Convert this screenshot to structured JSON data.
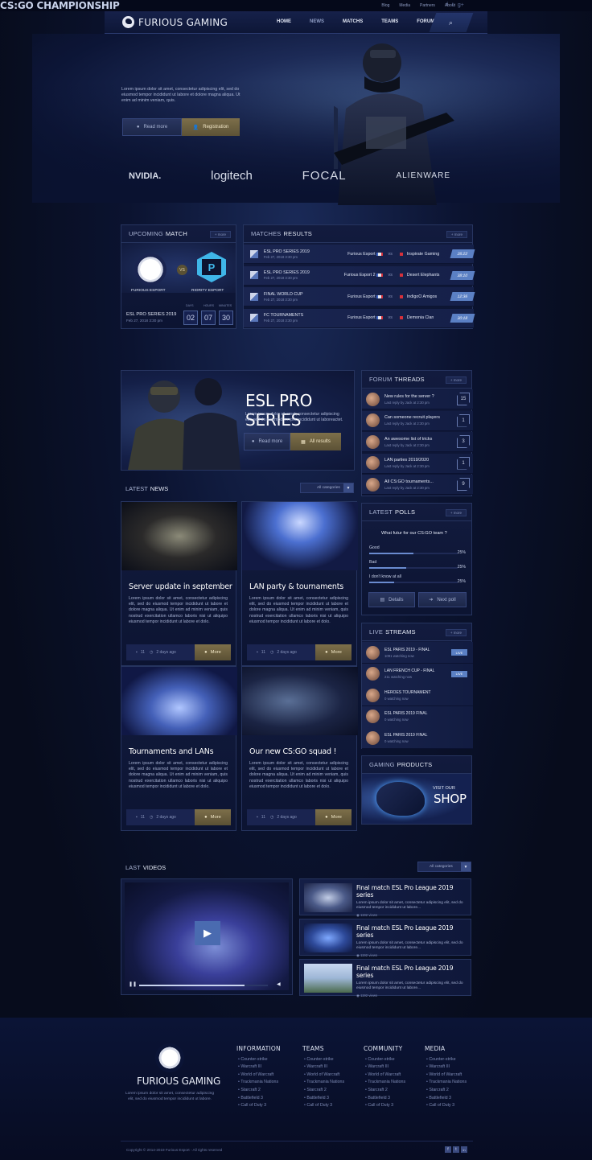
{
  "topbar": {
    "links": [
      "Blog",
      "Media",
      "Partners",
      "About"
    ],
    "social": [
      "f",
      "t",
      "g+"
    ]
  },
  "brand": {
    "name": "FURIOUS GAMING"
  },
  "nav": {
    "items": [
      "HOME",
      "NEWS",
      "MATCHS",
      "TEAMS",
      "FORUMS"
    ],
    "active": "NEWS"
  },
  "hero": {
    "title": "CS:GO CHAMPIONSHIP",
    "desc": "Lorem ipsum dolor sit amet, consectetur adipiscing elit, sed do eiusmod tempor incididunt ut labore et dolore magna aliqua. Ut enim ad minim veniam, quis.",
    "btn_read": "Read more",
    "btn_reg": "Registration"
  },
  "sponsors": [
    "NVIDIA.",
    "logitech",
    "FOCAL",
    "ALIENWARE"
  ],
  "upcoming": {
    "title_a": "UPCOMING",
    "title_b": "MATCH",
    "more": "+ more",
    "team1": "FURIOUS ESPORT",
    "team2": "RIORITY ESPORT",
    "vs": "VS",
    "event": "ESL PRO SERIES 2019",
    "date": "Feb 27, 2018 3:30 pm",
    "cd_labels": [
      "DAYS",
      "HOURS",
      "MINUTES"
    ],
    "cd_values": [
      "02",
      "07",
      "30"
    ]
  },
  "results": {
    "title_a": "MATCHES",
    "title_b": "RESULTS",
    "more": "+ more",
    "rows": [
      {
        "event": "ESL PRO SERIES 2019",
        "date": "Feb 27, 2018 3:30 pm",
        "home": "Furious Esport",
        "away": "Inspirate Gaming",
        "score": "26:22"
      },
      {
        "event": "ESL PRO SERIES 2019",
        "date": "Feb 27, 2018 3:30 pm",
        "home": "Furious Esport 2",
        "away": "Desert Elephants",
        "score": "38:10"
      },
      {
        "event": "FINAL WORLD CUP",
        "date": "Feb 27, 2018 3:30 pm",
        "home": "Furious Esport",
        "away": "IndigoO Amigos",
        "score": "12:36"
      },
      {
        "event": "FC TOURNAMENTS",
        "date": "Feb 27, 2018 3:30 pm",
        "home": "Furious Esport",
        "away": "Demonia Clan",
        "score": "30:18"
      }
    ],
    "vs": "vs"
  },
  "esl": {
    "title": "ESL PRO SERIES",
    "desc": "Lorem ipsum dolor sit amet, consectetur adipiscing elit, sed do eiusmod tempor incididunt ut laboreactet.",
    "btn_read": "Read more",
    "btn_all": "All results"
  },
  "threads": {
    "title_a": "FORUM",
    "title_b": "THREADS",
    "more": "+ more",
    "rows": [
      {
        "title": "New rules for the server ?",
        "meta": "Last reply by Jack at 2:30 pm",
        "count": "15"
      },
      {
        "title": "Can someone recruit players",
        "meta": "Last reply by Jack at 2:30 pm",
        "count": "1"
      },
      {
        "title": "An awesome list of tricks",
        "meta": "Last reply by Jack at 2:30 pm",
        "count": "3"
      },
      {
        "title": "LAN parties 2019/2020",
        "meta": "Last reply by Jack at 2:30 pm",
        "count": "1"
      },
      {
        "title": "All CS:GO tournaments...",
        "meta": "Last reply by Jack at 2:30 pm",
        "count": "9"
      }
    ]
  },
  "news": {
    "title_a": "LATEST",
    "title_b": "NEWS",
    "filter": "All categories",
    "items": [
      {
        "title": "Server update in september",
        "text": "Lorem ipsum dolor sit amet, consectetur adipiscing elit, sed do eiusmod tempor incididunt ut labore et dolore magna aliqua. Ut enim ad minim veniam, quis nostrud exercitation ullamco laboris nisi ut aliquipo eiusmod tempor incididunt ut labore et dolo.",
        "comments": "11",
        "ago": "2 days ago",
        "more": "More"
      },
      {
        "title": "LAN party & tournaments",
        "text": "Lorem ipsum dolor sit amet, consectetur adipiscing elit, sed do eiusmod tempor incididunt ut labore et dolore magna aliqua. Ut enim ad minim veniam, quis nostrud exercitation ullamco laboris nisi ut aliquipo eiusmod tempor incididunt ut labore et dolo.",
        "comments": "11",
        "ago": "2 days ago",
        "more": "More"
      },
      {
        "title": "Tournaments and LANs",
        "text": "Lorem ipsum dolor sit amet, consectetur adipiscing elit, sed do eiusmod tempor incididunt ut labore et dolore magna aliqua. Ut enim ad minim veniam, quis nostrud exercitation ullamco laboris nisi ut aliquipo eiusmod tempor incididunt ut labore et dolo.",
        "comments": "11",
        "ago": "2 days ago",
        "more": "More"
      },
      {
        "title": "Our new CS:GO squad !",
        "text": "Lorem ipsum dolor sit amet, consectetur adipiscing elit, sed do eiusmod tempor incididunt ut labore et dolore magna aliqua. Ut enim ad minim veniam, quis nostrud exercitation ullamco laboris nisi ut aliquipo eiusmod tempor incididunt ut labore et dolo.",
        "comments": "11",
        "ago": "2 days ago",
        "more": "More"
      }
    ]
  },
  "polls": {
    "title_a": "LATEST",
    "title_b": "POLLS",
    "more": "+ more",
    "question": "What futur for our CS:GO team ?",
    "options": [
      {
        "label": "Good",
        "pct": "25%",
        "value": 0.5
      },
      {
        "label": "Bad",
        "pct": "25%",
        "value": 0.42
      },
      {
        "label": "I don't know at all",
        "pct": "25%",
        "value": 0.28
      }
    ],
    "btn_details": "Details",
    "btn_next": "Next poll"
  },
  "streams": {
    "title_a": "LIVE",
    "title_b": "STREAMS",
    "more": "+ more",
    "live": "LIVE",
    "rows": [
      {
        "title": "ESL PARIS 2019 - FINAL",
        "watch": "1091 watching now",
        "live": true
      },
      {
        "title": "LAN FRENCH CUP - FINAL",
        "watch": "211 watching now",
        "live": true
      },
      {
        "title": "HEROES TOURNAMENT",
        "watch": "0 watching now",
        "live": false
      },
      {
        "title": "ESL PARIS 2019 FINAL",
        "watch": "0 watching now",
        "live": false
      },
      {
        "title": "ESL PARIS 2019 FINAL",
        "watch": "0 watching now",
        "live": false
      }
    ]
  },
  "products": {
    "title_a": "GAMING",
    "title_b": "PRODUCTS",
    "visit": "VISIT OUR",
    "shop": "SHOP"
  },
  "videos": {
    "title_a": "LAST",
    "title_b": "VIDEOS",
    "filter": "All categories",
    "items": [
      {
        "title": "Final match ESL Pro League 2019 series",
        "desc": "Lorem ipsum dolor sit amet, consectetur adipiscing elit, sed do eiusmod tempor incididunt ut labore...",
        "views": "1192 views"
      },
      {
        "title": "Final match ESL Pro League 2019 series",
        "desc": "Lorem ipsum dolor sit amet, consectetur adipiscing elit, sed do eiusmod tempor incididunt ut labore...",
        "views": "1192 views"
      },
      {
        "title": "Final match ESL Pro League 2019 series",
        "desc": "Lorem ipsum dolor sit amet, consectetur adipiscing elit, sed do eiusmod tempor incididunt ut labore...",
        "views": "1192 views"
      }
    ],
    "progress": 0.82
  },
  "footer": {
    "brand": "FURIOUS GAMING",
    "desc": "Lorem ipsum dolor sit amet, consectetur adipiscing elit, sed do eiusmod tempor incididunt ut labore.",
    "cols": [
      {
        "title": "INFORMATION",
        "items": [
          "Counter-strike",
          "Warcraft III",
          "World of Warcraft",
          "Trackmania Nations",
          "Starcraft 2",
          "Battlefield 3",
          "Call of Duty 3"
        ]
      },
      {
        "title": "TEAMS",
        "items": [
          "Counter-strike",
          "Warcraft III",
          "World of Warcraft",
          "Trackmania Nations",
          "Starcraft 2",
          "Battlefield 3",
          "Call of Duty 3"
        ]
      },
      {
        "title": "COMMUNITY",
        "items": [
          "Counter-strike",
          "Warcraft III",
          "World of Warcraft",
          "Trackmania Nations",
          "Starcraft 2",
          "Battlefield 3",
          "Call of Duty 3"
        ]
      },
      {
        "title": "MEDIA",
        "items": [
          "Counter-strike",
          "Warcraft III",
          "World of Warcraft",
          "Trackmania Nations",
          "Starcraft 2",
          "Battlefield 3",
          "Call of Duty 3"
        ]
      }
    ],
    "copyright": "Copyright © 2014-2019 Furious Esport - All rights reserved",
    "social": [
      "f",
      "t",
      "in"
    ]
  }
}
